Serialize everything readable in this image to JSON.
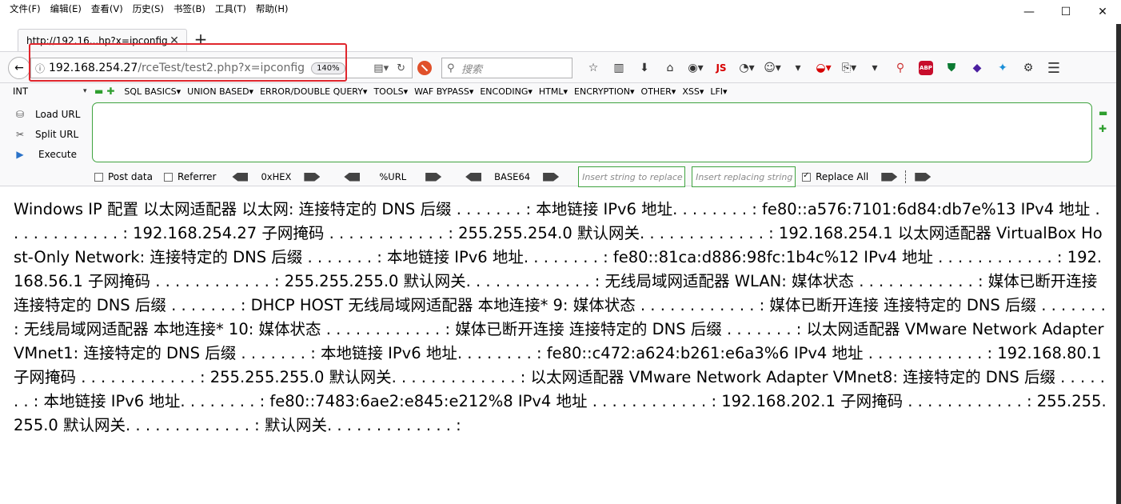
{
  "menubar": {
    "items": [
      "文件(F)",
      "编辑(E)",
      "查看(V)",
      "历史(S)",
      "书签(B)",
      "工具(T)",
      "帮助(H)"
    ]
  },
  "window_controls": {
    "minimize": "—",
    "maximize": "☐",
    "close": "✕"
  },
  "tab": {
    "title": "http://192.16...hp?x=ipconfig",
    "close": "✕"
  },
  "new_tab": "+",
  "navbar": {
    "back": "←",
    "url_host": "192.168.254.27",
    "url_path": "/rceTest/test2.php?x=ipconfig",
    "zoom": "140%",
    "reload": "↻",
    "search_placeholder": "搜索",
    "js_label": "JS",
    "abp_label": "ABP"
  },
  "hackbar": {
    "int_label": "INT",
    "menus": [
      "SQL BASICS▾",
      "UNION BASED▾",
      "ERROR/DOUBLE QUERY▾",
      "TOOLS▾",
      "WAF BYPASS▾",
      "ENCODING▾",
      "HTML▾",
      "ENCRYPTION▾",
      "OTHER▾",
      "XSS▾",
      "LFI▾"
    ],
    "load_url": "Load URL",
    "split_url": "Split URL",
    "execute": "Execute",
    "post_data": "Post data",
    "referrer": "Referrer",
    "hex": "0xHEX",
    "url_enc": "%URL",
    "base64": "BASE64",
    "insert_string_placeholder": "Insert string to replace",
    "insert_replacing_placeholder": "Insert replacing string",
    "replace_all": "Replace All"
  },
  "content": {
    "text": "Windows IP 配置 以太网适配器 以太网: 连接特定的 DNS 后缀 . . . . . . . : 本地链接 IPv6 地址. . . . . . . . : fe80::a576:7101:6d84:db7e%13 IPv4 地址 . . . . . . . . . . . . : 192.168.254.27 子网掩码 . . . . . . . . . . . . : 255.255.254.0 默认网关. . . . . . . . . . . . . : 192.168.254.1 以太网适配器 VirtualBox Host-Only Network: 连接特定的 DNS 后缀 . . . . . . . : 本地链接 IPv6 地址. . . . . . . . : fe80::81ca:d886:98fc:1b4c%12 IPv4 地址 . . . . . . . . . . . . : 192.168.56.1 子网掩码 . . . . . . . . . . . . : 255.255.255.0 默认网关. . . . . . . . . . . . . : 无线局域网适配器 WLAN: 媒体状态 . . . . . . . . . . . . : 媒体已断开连接 连接特定的 DNS 后缀 . . . . . . . : DHCP HOST 无线局域网适配器 本地连接* 9: 媒体状态 . . . . . . . . . . . . : 媒体已断开连接 连接特定的 DNS 后缀 . . . . . . . : 无线局域网适配器 本地连接* 10: 媒体状态 . . . . . . . . . . . . : 媒体已断开连接 连接特定的 DNS 后缀 . . . . . . . : 以太网适配器 VMware Network Adapter VMnet1: 连接特定的 DNS 后缀 . . . . . . . : 本地链接 IPv6 地址. . . . . . . . : fe80::c472:a624:b261:e6a3%6 IPv4 地址 . . . . . . . . . . . . : 192.168.80.1 子网掩码 . . . . . . . . . . . . : 255.255.255.0 默认网关. . . . . . . . . . . . . : 以太网适配器 VMware Network Adapter VMnet8: 连接特定的 DNS 后缀 . . . . . . . : 本地链接 IPv6 地址. . . . . . . . : fe80::7483:6ae2:e845:e212%8 IPv4 地址 . . . . . . . . . . . . : 192.168.202.1 子网掩码 . . . . . . . . . . . . : 255.255.255.0 默认网关. . . . . . . . . . . . . : 默认网关. . . . . . . . . . . . . :"
  },
  "colors": {
    "highlight": "#e0262d",
    "hackbar_green": "#3fa33f",
    "toolbar_bg": "#f9f9fa"
  }
}
